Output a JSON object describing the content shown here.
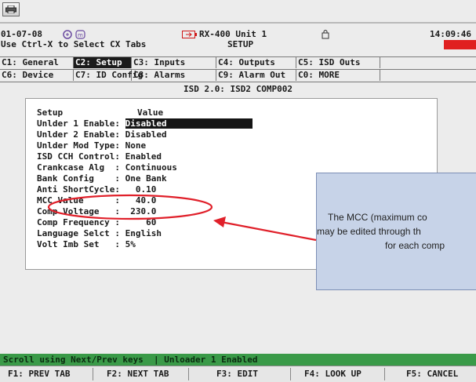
{
  "header": {
    "date": "01-07-08",
    "unit": "RX-400 Unit 1",
    "mode": "SETUP",
    "time": "14:09:46",
    "hint": "Use Ctrl-X to Select CX Tabs"
  },
  "tabs": [
    {
      "label": "C1: General"
    },
    {
      "label": "C2: Setup"
    },
    {
      "label": "C3: Inputs"
    },
    {
      "label": "C4: Outputs"
    },
    {
      "label": "C5: ISD Outs"
    },
    {
      "label": "C6: Device"
    },
    {
      "label": "C7: ID Config"
    },
    {
      "label": "C8: Alarms"
    },
    {
      "label": "C9: Alarm Out"
    },
    {
      "label": "C0: MORE"
    }
  ],
  "heading": "ISD 2.0: ISD2 COMP002",
  "setup": {
    "col_setup": "Setup",
    "col_value": "Value",
    "rows": [
      {
        "label": "Unlder 1 Enable:",
        "value": "Disabled"
      },
      {
        "label": "Unlder 2 Enable:",
        "value": "Disabled"
      },
      {
        "label": "Unlder Mod Type:",
        "value": "None"
      },
      {
        "label": "ISD CCH Control:",
        "value": "Enabled"
      },
      {
        "label": "Crankcase Alg  :",
        "value": "Continuous"
      },
      {
        "label": "Bank Config    :",
        "value": "One Bank"
      },
      {
        "label": "Anti ShortCycle:",
        "value": "  0.10"
      },
      {
        "label": "MCC Value      :",
        "value": "  40.0"
      },
      {
        "label": "Comp Voltage   :",
        "value": " 230.0"
      },
      {
        "label": "Comp Frequency :",
        "value": "    60"
      },
      {
        "label": "Language Selct :",
        "value": "English"
      },
      {
        "label": "Volt Imb Set   :",
        "value": "5%"
      }
    ]
  },
  "callout": {
    "lines": [
      "The MCC (maximum co",
      "may be edited through th",
      "for each comp"
    ]
  },
  "message": "Scroll using Next/Prev keys  | Unloader 1 Enabled",
  "fkeys": [
    {
      "label": "F1: PREV TAB"
    },
    {
      "label": "F2: NEXT TAB"
    },
    {
      "label": "F3: EDIT"
    },
    {
      "label": "F4: LOOK UP"
    },
    {
      "label": "F5: CANCEL"
    }
  ],
  "colors": {
    "active_tab": "#1b1b1b",
    "message_bar": "#3a9a48",
    "annotation_red": "#e0202a",
    "callout_fill": "#c7d3e8",
    "alarm_red": "#e02020"
  },
  "icons": [
    "printer-icon",
    "alarm-icon",
    "battery-icon",
    "key-icon",
    "lock-icon"
  ]
}
